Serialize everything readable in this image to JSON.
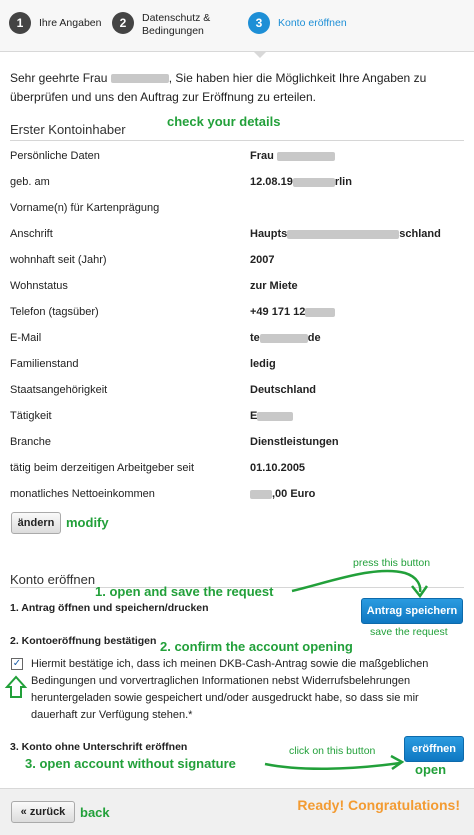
{
  "stepper": {
    "steps": [
      {
        "num": "1",
        "label": "Ihre Angaben"
      },
      {
        "num": "2",
        "label": "Datenschutz & Bedingungen"
      },
      {
        "num": "3",
        "label": "Konto eröffnen"
      }
    ],
    "active_color": "#1e8fd6"
  },
  "intro": {
    "before": "Sehr geehrte Frau ",
    "after": ", Sie haben hier die Möglichkeit Ihre Angaben zu überprüfen und uns den Auftrag zur Eröffnung zu erteilen."
  },
  "holder": {
    "title": "Erster Kontoinhaber",
    "annotation": "check your details",
    "rows": [
      {
        "label": "Persönliche Daten",
        "value": "Frau"
      },
      {
        "label": "geb. am",
        "value": "12.08.19",
        "value_suffix": "rlin"
      },
      {
        "label": "Vorname(n) für Kartenprägung",
        "value": ""
      },
      {
        "label": "Anschrift",
        "value": "Haupts",
        "value_suffix": "schland"
      },
      {
        "label": "wohnhaft seit (Jahr)",
        "value": "2007"
      },
      {
        "label": "Wohnstatus",
        "value": "zur Miete"
      },
      {
        "label": "Telefon (tagsüber)",
        "value": "+49 171 12"
      },
      {
        "label": "E-Mail",
        "value": "te",
        "value_suffix": "de"
      },
      {
        "label": "Familienstand",
        "value": "ledig"
      },
      {
        "label": "Staatsangehörigkeit",
        "value": "Deutschland"
      },
      {
        "label": "Tätigkeit",
        "value": "E"
      },
      {
        "label": "Branche",
        "value": "Dienstleistungen"
      },
      {
        "label": "tätig beim derzeitigen Arbeitgeber seit",
        "value": "01.10.2005"
      },
      {
        "label": "monatliches Nettoeinkommen",
        "value": "",
        "value_suffix": ",00 Euro"
      }
    ],
    "change_button": "ändern",
    "change_annotation": "modify"
  },
  "open": {
    "title": "Konto eröffnen",
    "step1_label": "1. Antrag öffnen und speichern/drucken",
    "step1_annotation": "1. open and save the request",
    "press_hint": "press this button",
    "save_button": "Antrag speichern",
    "save_hint": "save the request",
    "step2_label": "2. Kontoeröffnung bestätigen",
    "step2_annotation": "2. confirm the account opening",
    "confirm_checked": "✓",
    "confirm_text": "Hiermit bestätige ich, dass ich meinen DKB-Cash-Antrag sowie die maßgeblichen Bedingungen und vorvertraglichen Informationen nebst Widerrufsbelehrungen heruntergeladen sowie gespeichert und/oder ausgedruckt habe, so dass sie mir dauerhaft zur Verfügung stehen.*",
    "step3_label": "3. Konto ohne Unterschrift eröffnen",
    "step3_annotation": "3. open account without signature",
    "click_hint": "click on this button",
    "open_button": "eröffnen",
    "open_annotation": "open"
  },
  "footer": {
    "back_button": "« zurück",
    "back_annotation": "back",
    "ready": "Ready! Congratulations!"
  },
  "colors": {
    "annotation_green": "#22a03a",
    "button_blue": "#1e8fd6",
    "ready_orange": "#f39b32"
  }
}
